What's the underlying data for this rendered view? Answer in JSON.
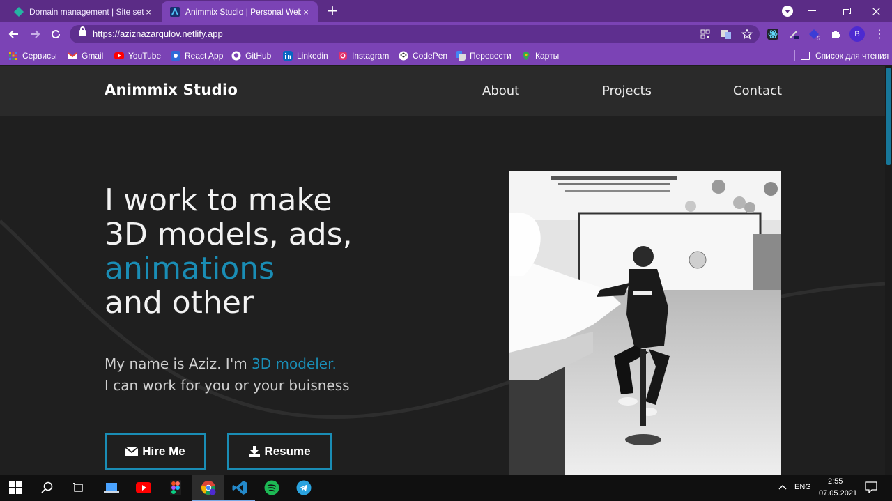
{
  "browser": {
    "tabs": [
      {
        "title": "Domain management | Site settin",
        "active": false
      },
      {
        "title": "Animmix Studio | Personal Websi",
        "active": true
      }
    ],
    "tab_close": "×",
    "new_tab": "+",
    "url": "https://aziznazarqulov.netlify.app",
    "profile_initial": "B",
    "extension_badge": "5",
    "bookmarks": [
      {
        "label": "Сервисы",
        "icon": "apps-icon",
        "color": "#f4b400"
      },
      {
        "label": "Gmail",
        "icon": "gmail-icon",
        "color": "#ea4335"
      },
      {
        "label": "YouTube",
        "icon": "youtube-icon",
        "color": "#ff0000"
      },
      {
        "label": "React App",
        "icon": "react-icon",
        "color": "#2f6ad9"
      },
      {
        "label": "GitHub",
        "icon": "github-icon",
        "color": "#ffffff"
      },
      {
        "label": "Linkedin",
        "icon": "linkedin-icon",
        "color": "#0a66c2"
      },
      {
        "label": "Instagram",
        "icon": "instagram-icon",
        "color": "#e1306c"
      },
      {
        "label": "CodePen",
        "icon": "codepen-icon",
        "color": "#ffffff"
      },
      {
        "label": "Перевести",
        "icon": "translate-icon",
        "color": "#4285f4"
      },
      {
        "label": "Карты",
        "icon": "maps-icon",
        "color": "#34a853"
      }
    ],
    "reading_list": "Список для чтения",
    "accent": "#7b43b5"
  },
  "site": {
    "logo": "Animmix Studio",
    "nav": [
      "About",
      "Projects",
      "Contact"
    ],
    "hero": {
      "line1": "I work to make",
      "line2": "3D models, ads,",
      "line3": "animations",
      "line4": "and other"
    },
    "intro_prefix": "My name is Aziz. I'm ",
    "intro_role": "3D modeler.",
    "intro_line2": "I can work for you or your buisness",
    "buttons": [
      {
        "label": "Hire Me",
        "icon": "envelope-icon"
      },
      {
        "label": "Resume",
        "icon": "download-icon"
      }
    ],
    "accent": "#1a8db5"
  },
  "taskbar": {
    "apps": [
      "windows-start-icon",
      "search-icon",
      "task-view-icon",
      "laptop-icon",
      "youtube-icon",
      "figma-icon",
      "chrome-icon",
      "vscode-icon",
      "spotify-icon",
      "telegram-icon"
    ],
    "language": "ENG",
    "time": "2:55",
    "date": "07.05.2021"
  }
}
